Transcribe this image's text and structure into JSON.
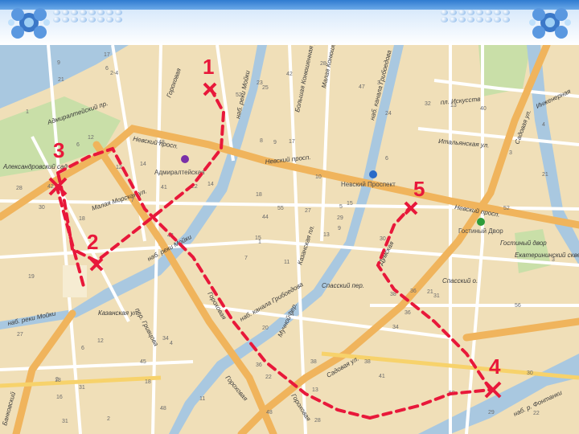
{
  "header": {
    "background_color": "#ffffff",
    "bar_color": "#2f7bd0",
    "decoration": "blue-flower-corner-ornaments"
  },
  "map": {
    "colors": {
      "blocks": "#f0dfb8",
      "water": "#a9c8e0",
      "major_road": "#f0b45c",
      "park": "#c9dfa8",
      "route": "#e8183a"
    },
    "streets": {
      "nevsky_1": "Невский просп.",
      "nevsky_2": "Невский просп.",
      "nevsky_3": "Невский просп.",
      "admiralteysky": "Адмиралтейский пр.",
      "malaya_morskaya": "Малая Морская ул.",
      "nab_reki_moyki": "наб. реки Мойки",
      "nab_reki_moyki_2": "наб. реки Мойки",
      "nab_reki_moyki_3": "наб. реки Мойки",
      "kazanskaya": "Казанская ул.",
      "kanal_griboedova": "наб. канала Грибоедова",
      "kanal_griboedova_2": "наб. канала Грибоедова",
      "sadovaya_1": "Садовая ул.",
      "sadovaya_2": "Садовая ул.",
      "italyanskaya": "Итальянская ул.",
      "inzhenernaya": "Инженерная",
      "gorokhovaya": "Гороховая",
      "gorokhovaya_2": "Гороховая",
      "gorokhovaya_3": "Гороховая",
      "bolshaya_konyushennaya": "Большая Конюшенная ул.",
      "malaya_konyushennaya": "Малая Конюшенная ул.",
      "kazansky": "Казанская пл.",
      "spassky": "Спасский пер.",
      "spassky_o": "Спасский о.",
      "grivtsova": "пер. Гривцова",
      "dumskaya": "Думская",
      "plisheva": "пл. Искусств",
      "gostiny": "Гостиный двор",
      "ekaterininsky": "Екатерининский сквер",
      "nab_fontanki": "наб. р. Фонтанки",
      "bankovsky": "Банковский",
      "mozhaysky": "Мучной пер.",
      "rubinshteyna": "Гороховая"
    },
    "metro": {
      "admiralteyskaya": "Адмиралтейская",
      "nevsky_prospekt": "Невский Проспект",
      "gostiny_dvor": "Гостиный Двор",
      "icon": "metro-m-icon"
    },
    "places": {
      "aleksandrovsky_sad": "Александровский сад"
    },
    "building_numbers": [
      "11",
      "6",
      "1",
      "2",
      "5",
      "4",
      "3",
      "17",
      "24",
      "13",
      "2-4",
      "22",
      "18",
      "4",
      "7",
      "6",
      "2",
      "8",
      "10",
      "12",
      "14",
      "16",
      "18",
      "9",
      "15",
      "31",
      "12",
      "25",
      "30",
      "38",
      "21",
      "15",
      "36",
      "44",
      "48",
      "32",
      "34",
      "29",
      "30",
      "21",
      "28",
      "22",
      "7",
      "34",
      "48",
      "28",
      "29",
      "31",
      "22",
      "9",
      "6",
      "3",
      "1",
      "36",
      "41",
      "45",
      "6",
      "9",
      "38",
      "40",
      "42",
      "43",
      "42",
      "14",
      "13",
      "17",
      "47",
      "52",
      "55",
      "27",
      "20",
      "11",
      "36",
      "41",
      "18",
      "21",
      "12",
      "19",
      "18",
      "13",
      "27",
      "31",
      "30",
      "56",
      "48",
      "52",
      "54",
      "58",
      "28",
      "38",
      "23",
      "3"
    ],
    "route": {
      "points": [
        "1",
        "2",
        "3",
        "4",
        "5"
      ]
    }
  }
}
